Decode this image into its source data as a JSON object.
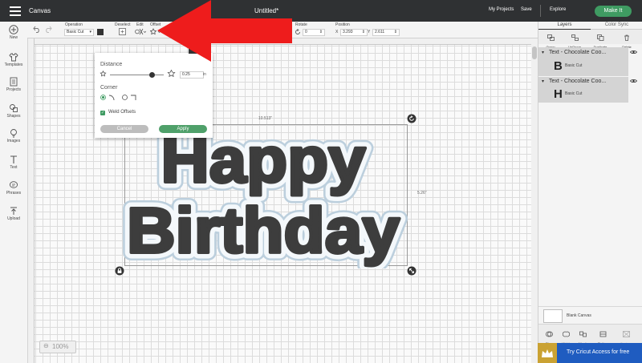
{
  "topbar": {
    "app": "Canvas",
    "title": "Untitled*",
    "my_projects": "My Projects",
    "save": "Save",
    "explore": "Explore",
    "make_it": "Make It"
  },
  "toolbar": {
    "operation_label": "Operation",
    "operation_value": "Basic Cut",
    "deselect": "Deselect",
    "edit": "Edit",
    "offset": "Offset",
    "rotate": "Rotate",
    "rotate_value": "0",
    "position": "Position",
    "x_label": "X",
    "x_value": "3.293",
    "y_label": "Y",
    "y_value": "2.611"
  },
  "leftrail": [
    {
      "label": "New",
      "icon": "plus-icon"
    },
    {
      "label": "Templates",
      "icon": "shirt-icon"
    },
    {
      "label": "Projects",
      "icon": "grid-icon"
    },
    {
      "label": "Shapes",
      "icon": "shapes-icon"
    },
    {
      "label": "Images",
      "icon": "bulb-icon"
    },
    {
      "label": "Text",
      "icon": "text-icon"
    },
    {
      "label": "Phrases",
      "icon": "phrase-icon"
    },
    {
      "label": "Upload",
      "icon": "upload-icon"
    }
  ],
  "popup": {
    "distance_label": "Distance",
    "distance_value": "0.25",
    "distance_unit": "in",
    "distance_fraction": 0.78,
    "corner_label": "Corner",
    "weld_label": "Weld Offsets",
    "weld_checked": true,
    "cancel": "Cancel",
    "apply": "Apply"
  },
  "canvas": {
    "line1": "Happy",
    "line2": "Birthday",
    "width_label": "10.513\"",
    "height_label": "5.26\"",
    "zoom": "100%"
  },
  "rightpanel": {
    "tab_layers": "Layers",
    "tab_color_sync": "Color Sync",
    "actions": [
      "Group",
      "UnGroup",
      "Duplicate",
      "Delete"
    ],
    "layers": [
      {
        "name": "Text - Chocolate Coo...",
        "letter": "B",
        "op": "Basic Cut"
      },
      {
        "name": "Text - Chocolate Coo...",
        "letter": "H",
        "op": "Basic Cut"
      }
    ],
    "blank_canvas": "Blank Canvas",
    "bottom_actions": [
      "Slice",
      "Weld",
      "Attach",
      "Flatten",
      "Contour"
    ],
    "try_banner": "Try Cricut Access for free"
  },
  "colors": {
    "accent": "#3f9b62",
    "topbar": "#2f3133",
    "banner": "#1f5cc0",
    "arrow": "#ee1c1c",
    "text_fill": "#3d3d3d"
  }
}
